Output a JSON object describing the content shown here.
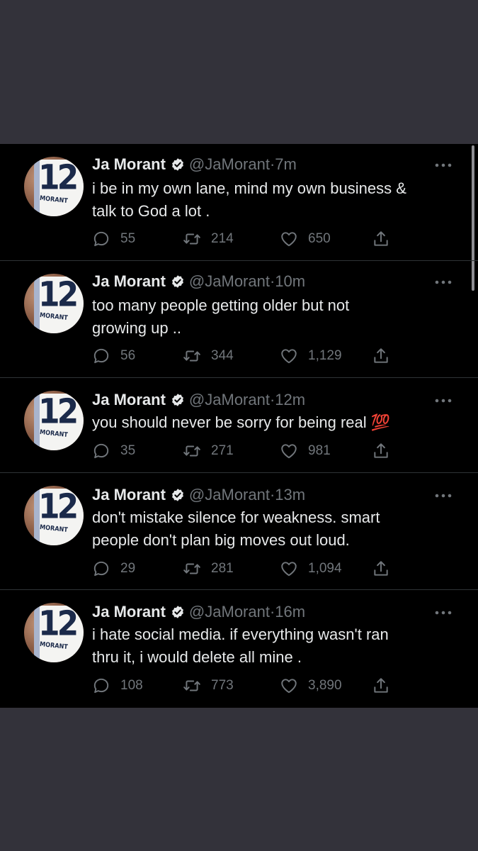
{
  "author": {
    "name": "Ja Morant",
    "handle": "@JaMorant",
    "avatar": {
      "jersey_number": "12",
      "jersey_name": "MORANT"
    }
  },
  "separator": "·",
  "colors": {
    "page_bg": "#33323a",
    "timeline_bg": "#000000",
    "text": "#e7e9ea",
    "secondary_text": "#71767b",
    "divider": "#2f3336"
  },
  "icons": {
    "reply": "reply-icon",
    "retweet": "retweet-icon",
    "like": "heart-icon",
    "share": "share-icon",
    "verified": "verified-badge-icon",
    "more": "more-options-icon"
  },
  "tweets": [
    {
      "time": "7m",
      "text_lines": [
        "i be in my own lane, mind my own business &",
        "talk to God a lot ."
      ],
      "replies": "55",
      "retweets": "214",
      "likes": "650"
    },
    {
      "time": "10m",
      "text_lines": [
        "too many people getting older but not",
        "growing up .."
      ],
      "replies": "56",
      "retweets": "344",
      "likes": "1,129"
    },
    {
      "time": "12m",
      "text_lines": [
        "you should never be sorry for being real 💯"
      ],
      "replies": "35",
      "retweets": "271",
      "likes": "981"
    },
    {
      "time": "13m",
      "text_lines": [
        "don't mistake silence for weakness. smart",
        "people don't plan big moves out loud."
      ],
      "replies": "29",
      "retweets": "281",
      "likes": "1,094"
    },
    {
      "time": "16m",
      "text_lines": [
        "i hate social media. if everything wasn't ran",
        "thru it, i would delete all mine ."
      ],
      "replies": "108",
      "retweets": "773",
      "likes": "3,890"
    }
  ]
}
